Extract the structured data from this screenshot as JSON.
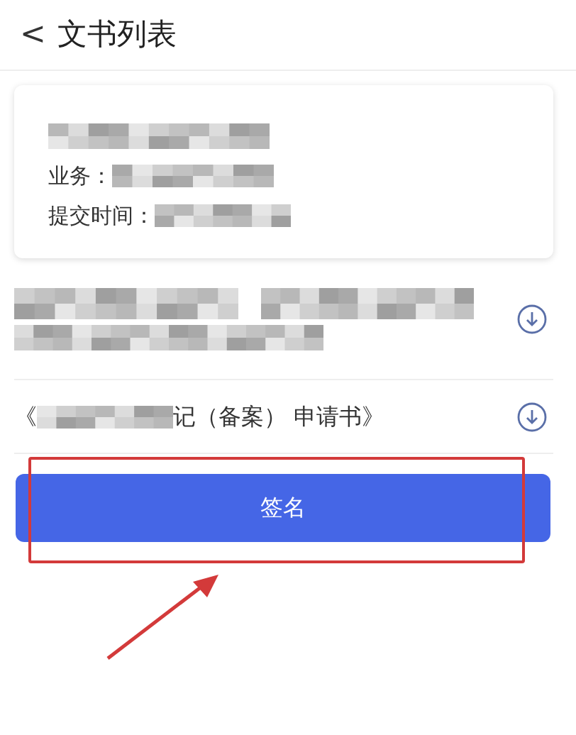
{
  "header": {
    "back": "<",
    "title": "文书列表"
  },
  "card": {
    "fields": [
      {
        "kind": "redacted"
      },
      {
        "kind": "labeled",
        "label": "业务："
      },
      {
        "kind": "labeled",
        "label": "提交时间："
      }
    ]
  },
  "documents": [
    {
      "kind": "redacted"
    },
    {
      "kind": "partial",
      "prefix": "《",
      "suffix": "记（备案） 申请书》"
    }
  ],
  "sign_button": "签名",
  "annotation": {
    "highlight": true
  }
}
